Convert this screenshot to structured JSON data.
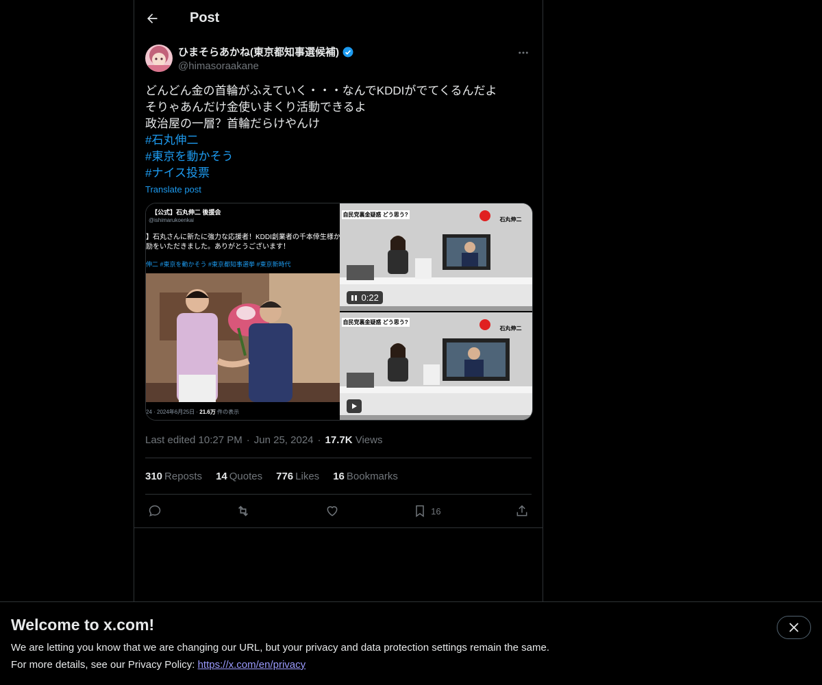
{
  "header": {
    "title": "Post"
  },
  "author": {
    "display_name": "ひまそらあかね(東京都知事選候補)",
    "handle": "@himasoraakane"
  },
  "post": {
    "lines": [
      "どんどん金の首輪がふえていく・・・なんでKDDIがでてくるんだよ",
      "そりゃあんだけ金使いまくり活動できるよ",
      "政治屋の一層？首輪だらけやんけ"
    ],
    "hashtags": [
      "#石丸伸二",
      "#東京を動かそう",
      "#ナイス投票"
    ],
    "translate_label": "Translate post"
  },
  "media": {
    "left_title": "【公式】石丸伸二 後援会",
    "left_handle": "@ishimarukoenkai",
    "left_text1": "】石丸さんに新たに強力な応援者！KDDI創業者の千本倖生様か",
    "left_text2": "励をいただきました。ありがとうございます！",
    "left_tags": "伸二 #東京を動かそう #東京都知事選挙 #東京新時代",
    "left_footer_date": "24 · 2024年6月25日 ·",
    "left_footer_views": "21.6万",
    "left_footer_suffix": "件の表示",
    "video_caption": "自民党裏金疑惑 どう思う?",
    "video_name": "石丸伸二",
    "video_time": "0:22"
  },
  "meta": {
    "edited": "Last edited 10:27 PM",
    "date": "Jun 25, 2024",
    "views_count": "17.7K",
    "views_label": "Views",
    "sep": "·"
  },
  "stats": {
    "reposts_count": "310",
    "reposts_label": "Reposts",
    "quotes_count": "14",
    "quotes_label": "Quotes",
    "likes_count": "776",
    "likes_label": "Likes",
    "bookmarks_count": "16",
    "bookmarks_label": "Bookmarks"
  },
  "actions": {
    "bookmark_count": "16"
  },
  "banner": {
    "title": "Welcome to x.com!",
    "line1": "We are letting you know that we are changing our URL, but your privacy and data protection settings remain the same.",
    "line2_prefix": "For more details, see our Privacy Policy: ",
    "link": "https://x.com/en/privacy"
  },
  "colors": {
    "accent": "#1d9bf0",
    "background": "#000000",
    "muted": "#71767b",
    "border": "#2f3336"
  }
}
